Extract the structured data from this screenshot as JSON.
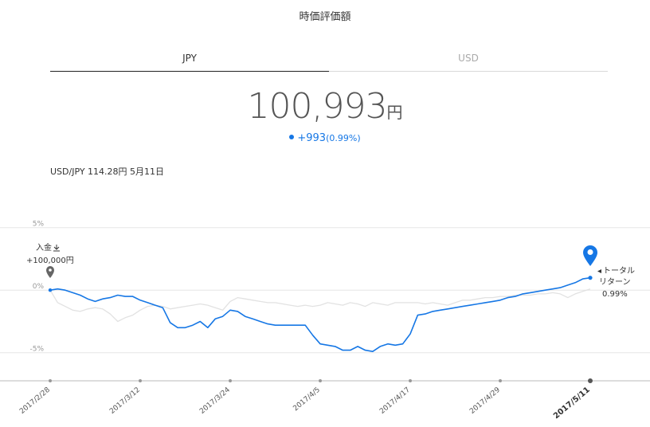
{
  "header": {
    "title": "時価評価額"
  },
  "tabs": [
    {
      "label": "JPY",
      "active": true
    },
    {
      "label": "USD",
      "active": false
    }
  ],
  "summary": {
    "amount": "100,993",
    "unit": "円",
    "change": "+993",
    "change_pct": "(0.99%)",
    "accent_color": "#1677e5"
  },
  "fx_rate": "USD/JPY 114.28円 5月11日",
  "deposit": {
    "label": "入金",
    "amount": "+100,000円",
    "icon": "download-icon"
  },
  "total_return": {
    "label_line1": "トータル",
    "label_line2": "リターン",
    "value": "0.99%"
  },
  "chart_data": {
    "type": "line",
    "ylim": [
      -7.5,
      6
    ],
    "yticks": [
      {
        "value": 5,
        "label": "5%"
      },
      {
        "value": 0,
        "label": "0%"
      },
      {
        "value": -5,
        "label": "-5%"
      }
    ],
    "xlabels": [
      "2017/2/28",
      "2017/3/12",
      "2017/3/24",
      "2017/4/5",
      "2017/4/17",
      "2017/4/29",
      "2017/5/11"
    ],
    "grid": true,
    "series": [
      {
        "color": "#1677e5",
        "x": [
          0,
          1,
          2,
          3,
          4,
          5,
          6,
          7,
          8,
          9,
          10,
          11,
          12,
          13,
          14,
          15,
          16,
          17,
          18,
          19,
          20,
          21,
          22,
          23,
          24,
          25,
          26,
          27,
          28,
          29,
          30,
          31,
          32,
          33,
          34,
          35,
          36,
          37,
          38,
          39,
          40,
          41,
          42,
          43,
          44,
          45,
          46,
          47,
          48,
          49,
          50,
          51,
          52,
          53,
          54,
          55,
          56,
          57,
          58,
          59,
          60,
          61,
          62,
          63,
          64,
          65,
          66,
          67,
          68,
          69,
          70,
          71,
          72
        ],
        "values": [
          0.0,
          0.1,
          0.0,
          -0.2,
          -0.4,
          -0.7,
          -0.9,
          -0.7,
          -0.6,
          -0.4,
          -0.5,
          -0.5,
          -0.8,
          -1.0,
          -1.2,
          -1.4,
          -2.6,
          -3.0,
          -3.0,
          -2.8,
          -2.5,
          -3.0,
          -2.3,
          -2.1,
          -1.6,
          -1.7,
          -2.1,
          -2.3,
          -2.5,
          -2.7,
          -2.8,
          -2.8,
          -2.8,
          -2.8,
          -2.8,
          -3.6,
          -4.3,
          -4.4,
          -4.5,
          -4.8,
          -4.8,
          -4.5,
          -4.8,
          -4.9,
          -4.5,
          -4.3,
          -4.4,
          -4.3,
          -3.5,
          -2.0,
          -1.9,
          -1.7,
          -1.6,
          -1.5,
          -1.4,
          -1.3,
          -1.2,
          -1.1,
          -1.0,
          -0.9,
          -0.8,
          -0.6,
          -0.5,
          -0.3,
          -0.2,
          -0.1,
          0.0,
          0.1,
          0.2,
          0.4,
          0.6,
          0.9,
          0.99
        ]
      },
      {
        "color": "#e2e2e2",
        "x": [
          0,
          1,
          2,
          3,
          4,
          5,
          6,
          7,
          8,
          9,
          10,
          11,
          12,
          13,
          14,
          15,
          16,
          17,
          18,
          19,
          20,
          21,
          22,
          23,
          24,
          25,
          26,
          27,
          28,
          29,
          30,
          31,
          32,
          33,
          34,
          35,
          36,
          37,
          38,
          39,
          40,
          41,
          42,
          43,
          44,
          45,
          46,
          47,
          48,
          49,
          50,
          51,
          52,
          53,
          54,
          55,
          56,
          57,
          58,
          59,
          60,
          61,
          62,
          63,
          64,
          65,
          66,
          67,
          68,
          69,
          70,
          71,
          72
        ],
        "values": [
          0.0,
          -1.0,
          -1.3,
          -1.6,
          -1.7,
          -1.5,
          -1.4,
          -1.5,
          -1.9,
          -2.5,
          -2.2,
          -2.0,
          -1.6,
          -1.3,
          -1.2,
          -1.3,
          -1.5,
          -1.4,
          -1.3,
          -1.2,
          -1.1,
          -1.2,
          -1.4,
          -1.6,
          -0.9,
          -0.6,
          -0.7,
          -0.8,
          -0.9,
          -1.0,
          -1.0,
          -1.1,
          -1.2,
          -1.3,
          -1.2,
          -1.3,
          -1.2,
          -1.0,
          -1.1,
          -1.2,
          -1.0,
          -1.1,
          -1.3,
          -1.0,
          -1.1,
          -1.2,
          -1.0,
          -1.0,
          -1.0,
          -1.0,
          -1.1,
          -1.0,
          -1.1,
          -1.2,
          -1.0,
          -0.8,
          -0.8,
          -0.7,
          -0.6,
          -0.6,
          -0.5,
          -0.5,
          -0.4,
          -0.4,
          -0.4,
          -0.3,
          -0.3,
          -0.2,
          -0.3,
          -0.6,
          -0.3,
          -0.1,
          0.1
        ]
      }
    ]
  }
}
